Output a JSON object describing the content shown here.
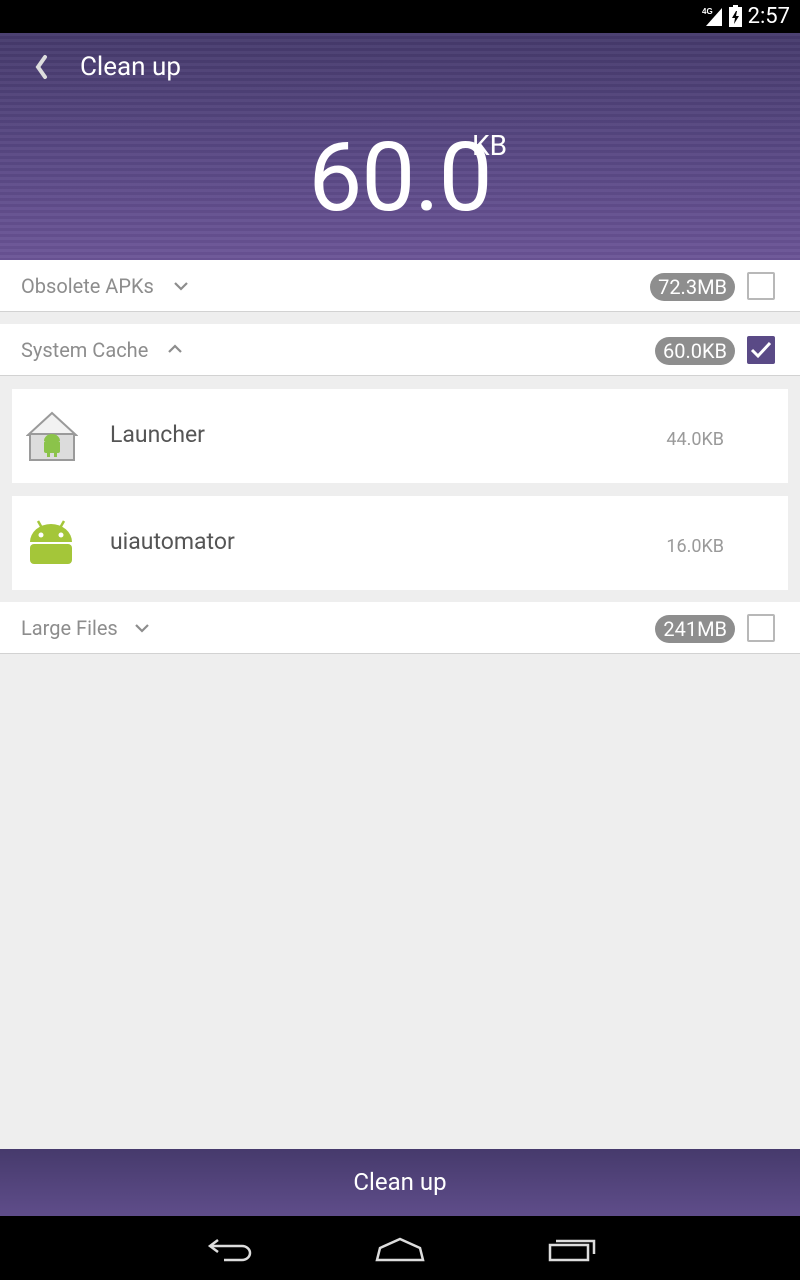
{
  "status_bar": {
    "network": "4G",
    "time": "2:57"
  },
  "header": {
    "title": "Clean up",
    "total_size_value": "60.0",
    "total_size_unit": "KB"
  },
  "sections": [
    {
      "label": "Obsolete APKs",
      "expanded": false,
      "size": "72.3MB",
      "checked": false
    },
    {
      "label": "System Cache",
      "expanded": true,
      "size": "60.0KB",
      "checked": true,
      "items": [
        {
          "name": "Launcher",
          "size": "44.0KB",
          "icon": "launcher-app-icon"
        },
        {
          "name": "uiautomator",
          "size": "16.0KB",
          "icon": "android-robot-icon"
        }
      ]
    },
    {
      "label": "Large Files",
      "expanded": false,
      "size": "241MB",
      "checked": false
    }
  ],
  "footer": {
    "clean_button_label": "Clean up"
  },
  "colors": {
    "accent": "#5a4a86",
    "header_top": "#463a6c",
    "header_bottom": "#6b5496"
  }
}
